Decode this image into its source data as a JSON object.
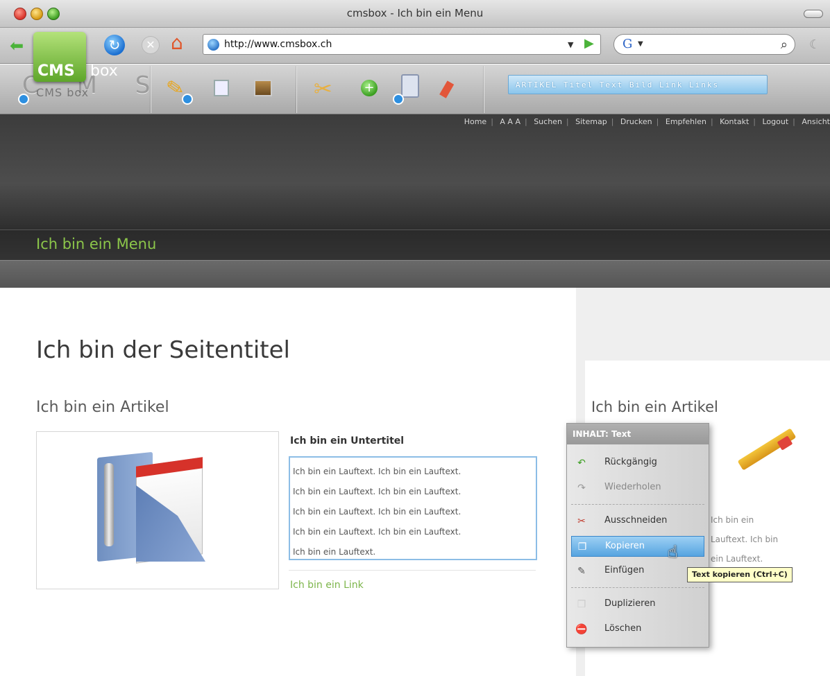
{
  "window": {
    "title": "cmsbox - Ich bin ein Menu"
  },
  "browser": {
    "url": "http://www.cmsbox.ch",
    "search_engine": "G"
  },
  "cms_toolbar": {
    "logo_letters": "C M S",
    "format_strip": "ARTIKEL  Titel  Text  Bild  Link  Links"
  },
  "site": {
    "topnav": [
      "Home",
      "A A A",
      "Suchen",
      "Sitemap",
      "Drucken",
      "Empfehlen",
      "Kontakt",
      "Logout",
      "Ansicht"
    ],
    "logo_cms": "CMS",
    "logo_box": "box",
    "logo_reflection": "CMS box",
    "menu_title": "Ich bin ein Menu"
  },
  "content": {
    "page_title": "Ich bin der Seitentitel",
    "article_title": "Ich bin ein Artikel",
    "subtitle": "Ich bin ein Untertitel",
    "body_lines": [
      "Ich bin ein Lauftext. Ich bin ein Lauftext.",
      "Ich bin ein Lauftext. Ich bin ein Lauftext.",
      "Ich bin ein Lauftext. Ich bin ein Lauftext.",
      "Ich bin ein Lauftext. Ich bin ein Lauftext.",
      "Ich bin ein Lauftext."
    ],
    "link_text": "Ich bin ein Link"
  },
  "sidebar": {
    "article_title": "Ich bin ein Artikel",
    "body_lines": [
      "Ich bin ein",
      "Lauftext. Ich bin",
      "ein Lauftext."
    ]
  },
  "context_menu": {
    "header": "INHALT: Text",
    "items": [
      {
        "label": "Rückgängig",
        "icon": "undo-icon"
      },
      {
        "label": "Wiederholen",
        "icon": "redo-icon"
      },
      {
        "label": "Ausschneiden",
        "icon": "scissors-icon"
      },
      {
        "label": "Kopieren",
        "icon": "copy-icon"
      },
      {
        "label": "Einfügen",
        "icon": "paste-icon"
      },
      {
        "label": "Duplizieren",
        "icon": "duplicate-icon"
      },
      {
        "label": "Löschen",
        "icon": "delete-icon"
      }
    ],
    "active_item": "Kopieren"
  },
  "tooltip": {
    "text": "Text kopieren (Ctrl+C)"
  },
  "colors": {
    "accent_green": "#8cc64a",
    "link_green": "#7cb54a",
    "header_dark": "#3c3c3c",
    "selection_blue": "#56a4e0",
    "tooltip_bg": "#ffffc8"
  }
}
